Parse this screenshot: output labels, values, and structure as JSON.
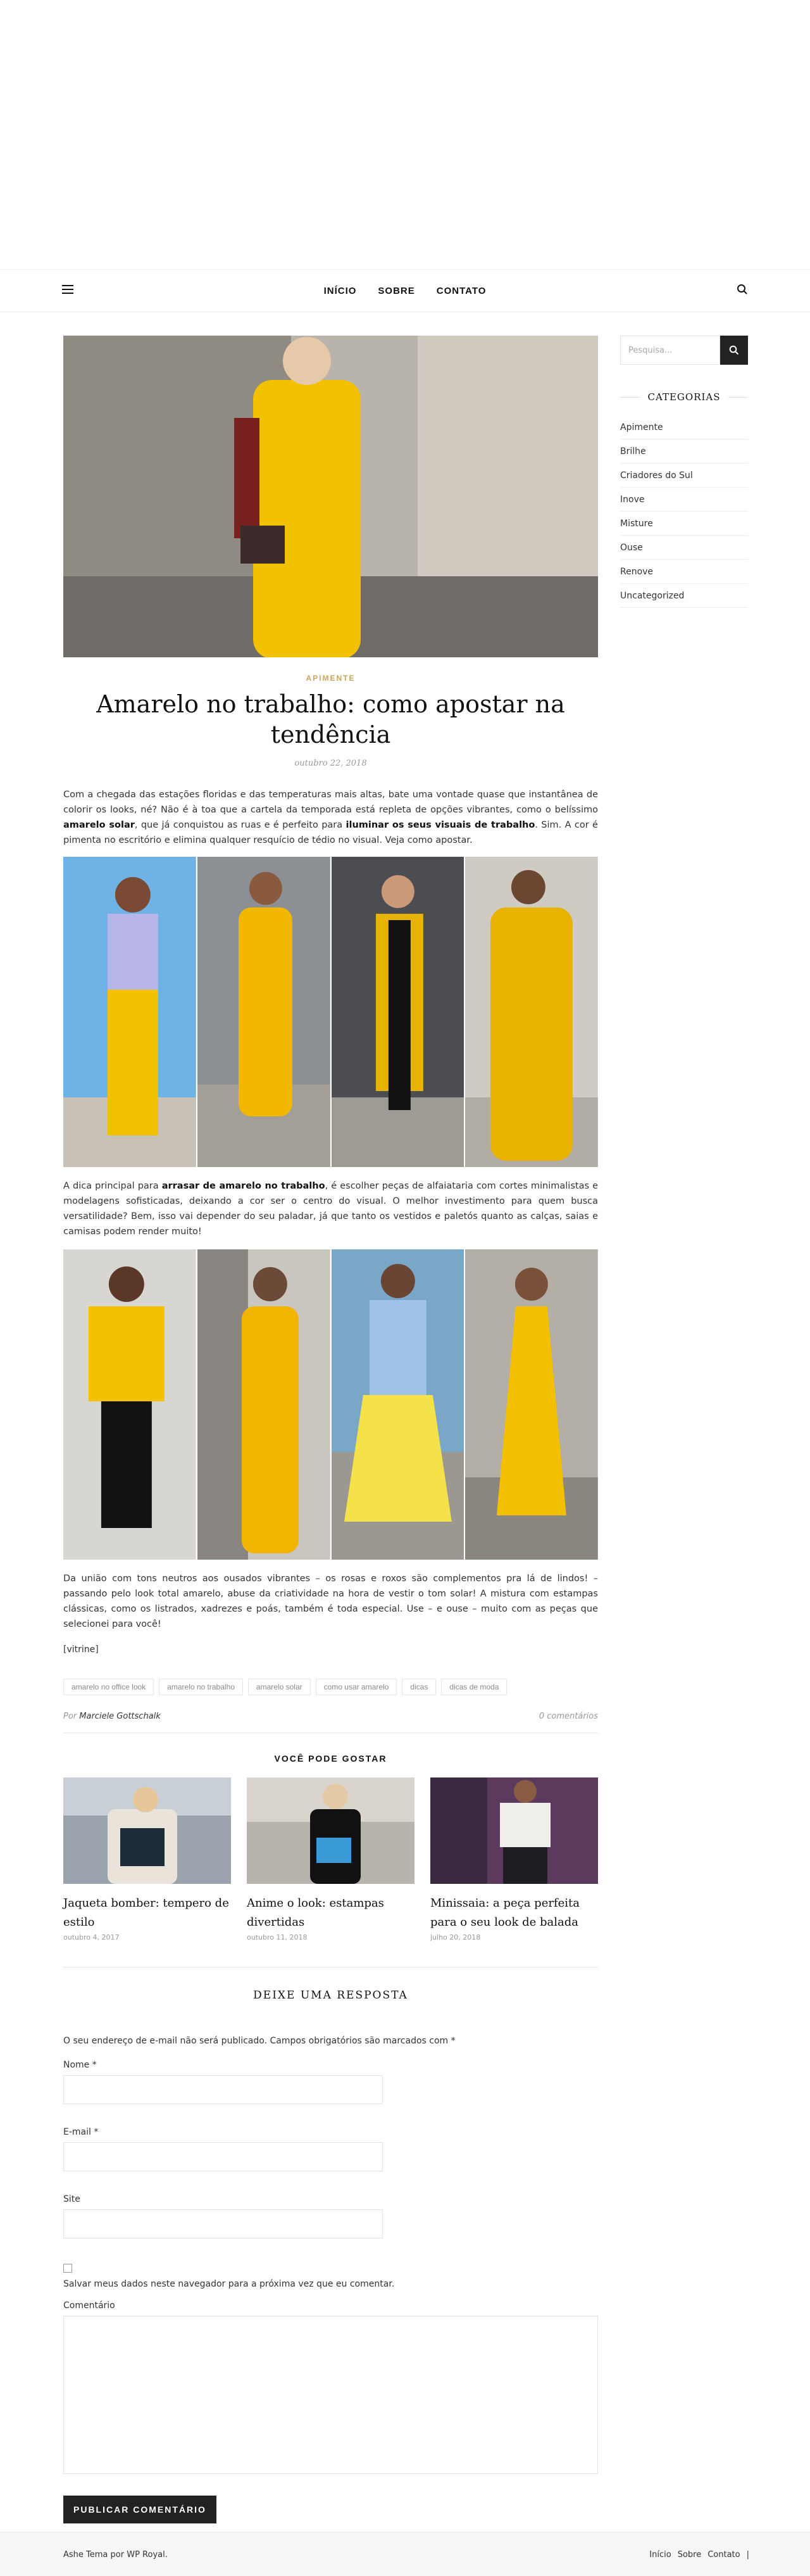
{
  "nav": {
    "items": [
      "INÍCIO",
      "SOBRE",
      "CONTATO"
    ]
  },
  "post": {
    "category": "APIMENTE",
    "title": "Amarelo no trabalho: como apostar na tendência",
    "date": "outubro 22, 2018",
    "p1_a": "Com a chegada das estações floridas e das temperaturas mais altas, bate uma vontade quase que instantânea de colorir os looks, né? Não é à toa que a cartela da temporada está repleta de opções vibrantes, como o belíssimo ",
    "p1_b": "amarelo solar",
    "p1_c": ", que já conquistou as ruas e é perfeito para ",
    "p1_d": "iluminar os seus visuais de trabalho",
    "p1_e": ". Sim. A cor é pimenta no escritório e elimina qualquer resquício de tédio no visual. Veja como apostar.",
    "p2_a": "A dica principal para ",
    "p2_b": "arrasar de amarelo no trabalho",
    "p2_c": ", é escolher peças de alfaiataria com cortes minimalistas e modelagens sofisticadas, deixando a cor ser o centro do visual. O melhor investimento para quem busca versatilidade? Bem, isso vai depender do seu paladar, já que tanto os vestidos e paletós quanto as calças, saias e camisas podem render muito!",
    "p3": "Da união com tons neutros aos ousados vibrantes – os rosas e roxos são complementos pra lá de lindos! – passando pelo look total amarelo, abuse da criatividade na hora de vestir o tom solar! A mistura com estampas clássicas, como os listrados, xadrezes e poás, também é toda especial. Use – e ouse – muito com as peças que selecionei para você!",
    "vitrine": "[vitrine]",
    "tags": [
      "amarelo no office look",
      "amarelo no trabalho",
      "amarelo solar",
      "como usar amarelo",
      "dicas",
      "dicas de moda"
    ],
    "by_prefix": "Por",
    "author": "Marciele Gottschalk",
    "comments": "0 comentários"
  },
  "related": {
    "heading": "VOCÊ PODE GOSTAR",
    "items": [
      {
        "title": "Jaqueta bomber: tempero de estilo",
        "date": "outubro 4, 2017"
      },
      {
        "title": "Anime o look: estampas divertidas",
        "date": "outubro 11, 2018"
      },
      {
        "title": "Minissaia: a peça perfeita para o seu look de balada",
        "date": "julho 20, 2018"
      }
    ]
  },
  "reply": {
    "heading": "DEIXE UMA RESPOSTA",
    "note": "O seu endereço de e-mail não será publicado. Campos obrigatórios são marcados com *",
    "name_label": "Nome *",
    "email_label": "E-mail *",
    "site_label": "Site",
    "save_label": "Salvar meus dados neste navegador para a próxima vez que eu comentar.",
    "comment_label": "Comentário",
    "submit": "PUBLICAR COMENTÁRIO"
  },
  "sidebar": {
    "search_placeholder": "Pesquisa...",
    "categories_heading": "CATEGORIAS",
    "categories": [
      "Apimente",
      "Brilhe",
      "Criadores do Sul",
      "Inove",
      "Misture",
      "Ouse",
      "Renove",
      "Uncategorized"
    ]
  },
  "footer": {
    "credit": "Ashe Tema por WP Royal.",
    "links": [
      "Início",
      "Sobre",
      "Contato",
      "|"
    ]
  },
  "colors": {
    "accent": "#c9a55a",
    "dark": "#222222",
    "yellow": "#f2c200"
  }
}
